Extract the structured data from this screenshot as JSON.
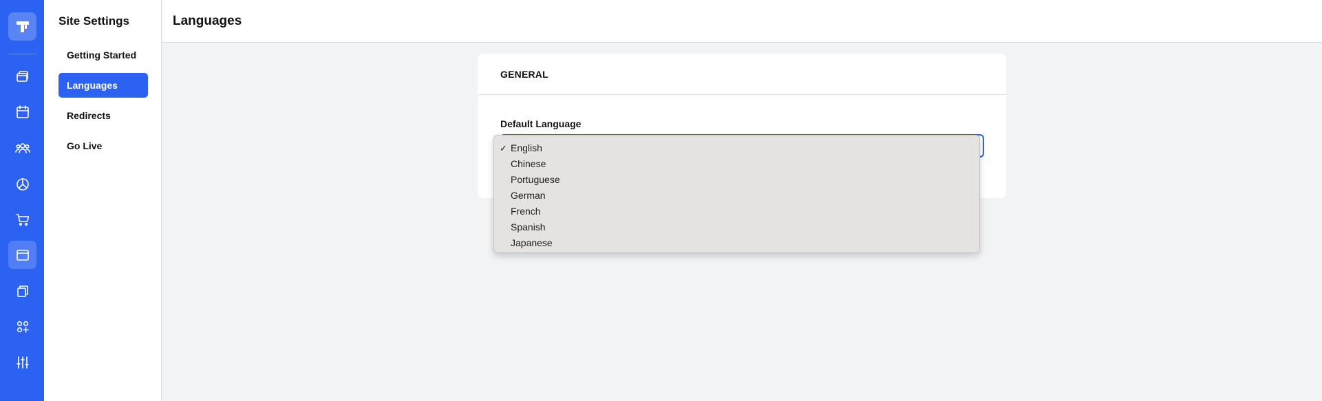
{
  "rail": {
    "logo_icon": "brand-logo-icon",
    "items": [
      {
        "icon": "windows-icon"
      },
      {
        "icon": "calendar-icon"
      },
      {
        "icon": "users-icon"
      },
      {
        "icon": "pie-chart-icon"
      },
      {
        "icon": "cart-icon"
      },
      {
        "icon": "browser-window-icon",
        "active": true
      },
      {
        "icon": "copy-pages-icon"
      },
      {
        "icon": "apps-add-icon"
      },
      {
        "icon": "sliders-icon"
      }
    ],
    "accent": "#2b62f2"
  },
  "sidebar": {
    "title": "Site Settings",
    "items": [
      {
        "label": "Getting Started"
      },
      {
        "label": "Languages",
        "active": true
      },
      {
        "label": "Redirects"
      },
      {
        "label": "Go Live"
      }
    ]
  },
  "header": {
    "title": "Languages"
  },
  "card": {
    "section_title": "GENERAL",
    "field_label": "Default Language",
    "selected": "English",
    "options": [
      "English",
      "Chinese",
      "Portuguese",
      "German",
      "French",
      "Spanish",
      "Japanese"
    ],
    "check_mark": "✓"
  }
}
